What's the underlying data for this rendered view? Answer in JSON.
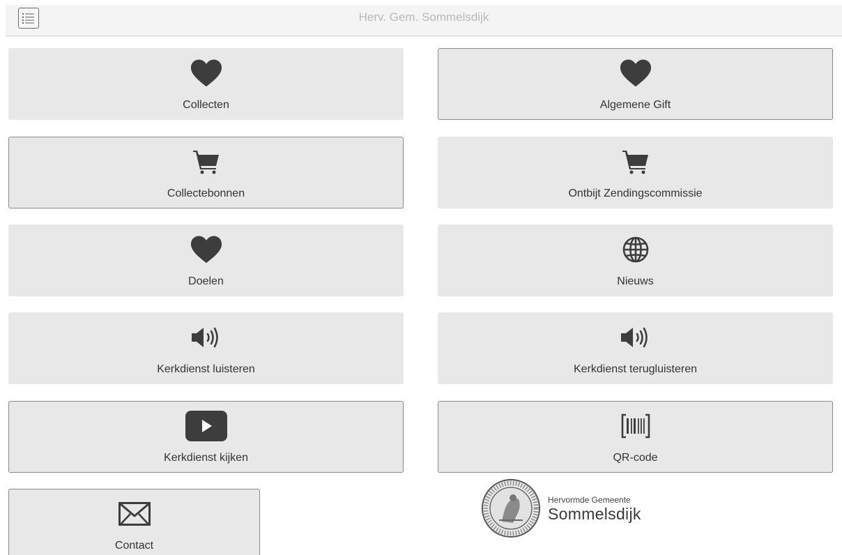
{
  "app": {
    "title": "Herv. Gem. Sommelsdijk"
  },
  "header": {
    "menu_icon": "list-icon"
  },
  "tiles": [
    {
      "label": "Collecten",
      "icon": "heart-icon"
    },
    {
      "label": "Algemene Gift",
      "icon": "heart-icon"
    },
    {
      "label": "Collectebonnen",
      "icon": "cart-icon"
    },
    {
      "label": "Ontbijt Zendingscommissie",
      "icon": "cart-icon"
    },
    {
      "label": "Doelen",
      "icon": "heart-icon"
    },
    {
      "label": "Nieuws",
      "icon": "globe-icon"
    },
    {
      "label": "Kerkdienst luisteren",
      "icon": "speaker-icon"
    },
    {
      "label": "Kerkdienst terugluisteren",
      "icon": "speaker-icon"
    },
    {
      "label": "Kerkdienst kijken",
      "icon": "play-icon"
    },
    {
      "label": "QR-code",
      "icon": "barcode-icon"
    },
    {
      "label": "Contact",
      "icon": "envelope-icon"
    }
  ],
  "logo": {
    "line1": "Hervormde Gemeente",
    "line2": "Sommelsdijk",
    "seal_icon": "church-seal-icon"
  },
  "colors": {
    "tile_bg": "#e8e8e8",
    "icon": "#3d3d3d",
    "title": "#b9b9b9"
  }
}
